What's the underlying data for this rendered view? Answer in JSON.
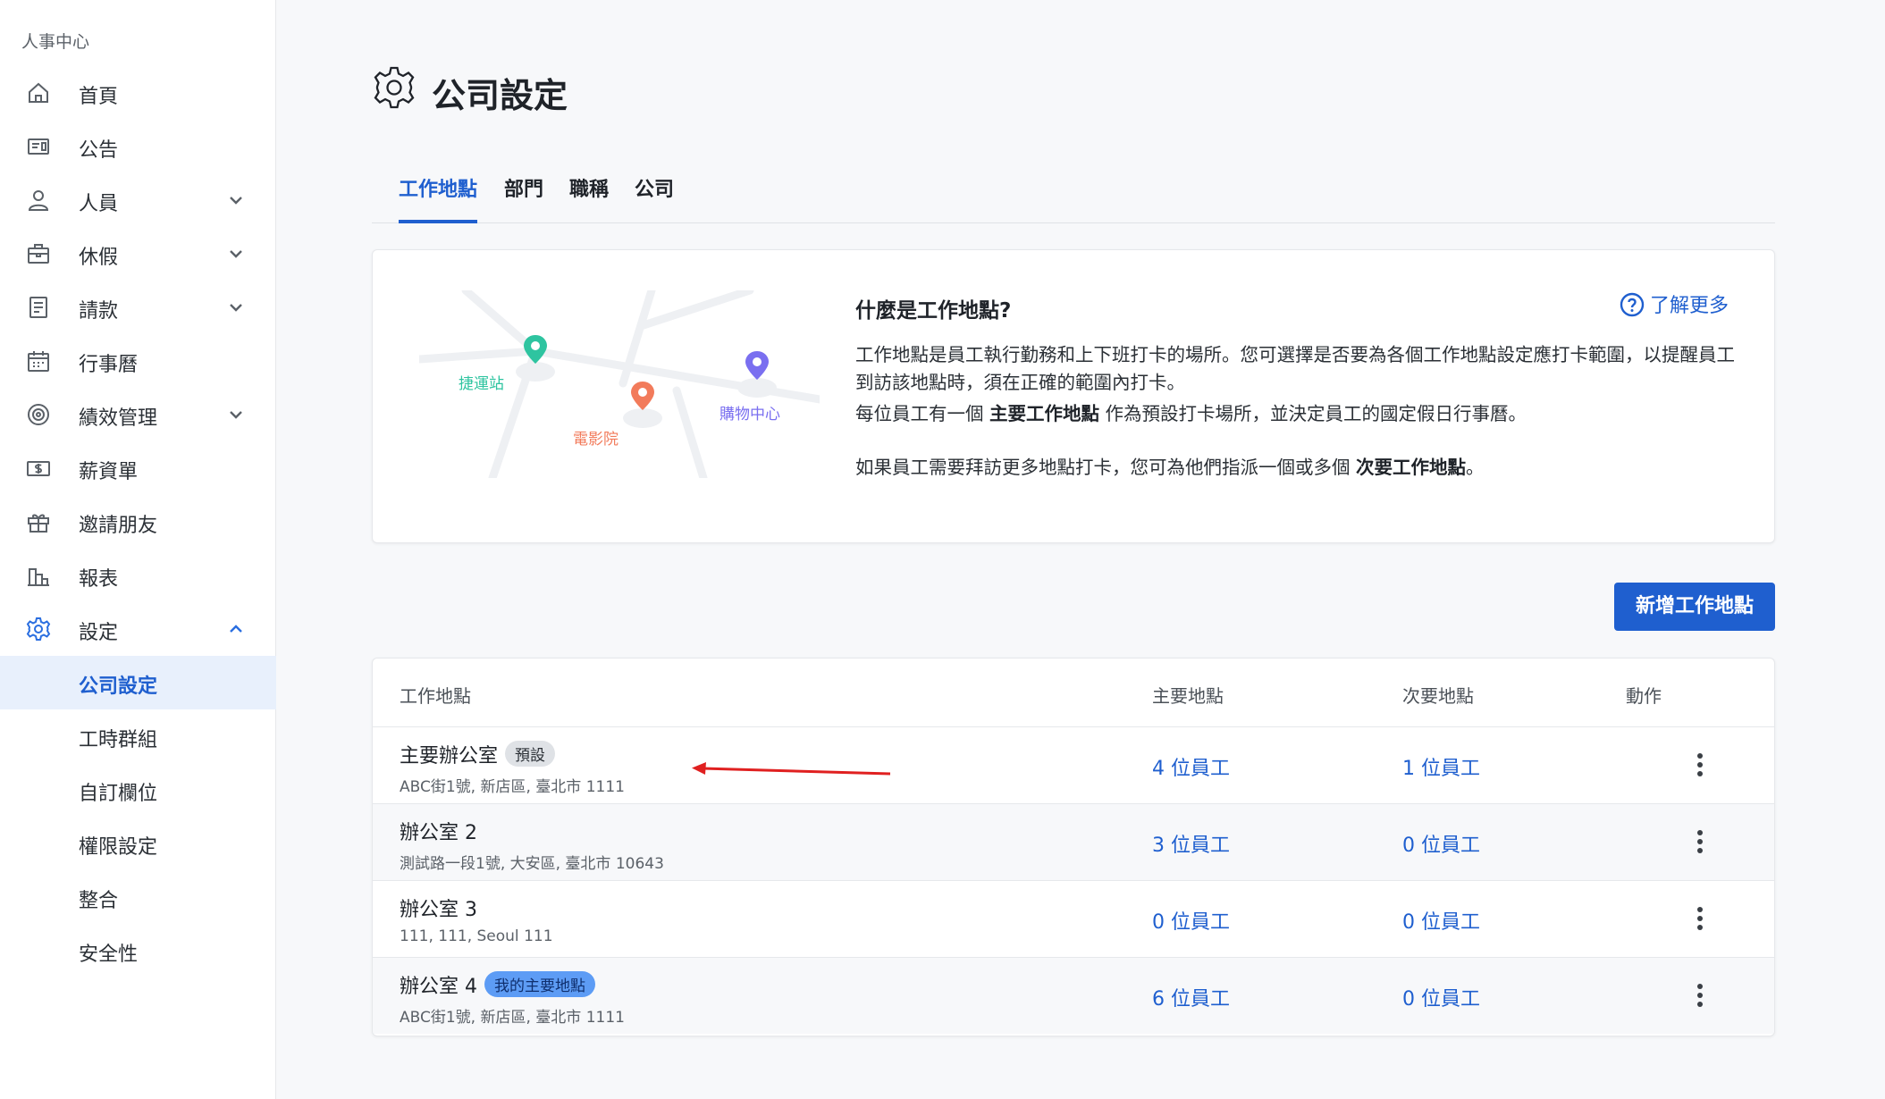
{
  "sidebar": {
    "org_name": "人事中心",
    "items": [
      {
        "label": "首頁",
        "icon": "home-icon"
      },
      {
        "label": "公告",
        "icon": "announcement-icon"
      },
      {
        "label": "人員",
        "icon": "person-icon"
      },
      {
        "label": "休假",
        "icon": "briefcase-icon"
      },
      {
        "label": "請款",
        "icon": "document-icon"
      },
      {
        "label": "行事曆",
        "icon": "calendar-icon"
      },
      {
        "label": "績效管理",
        "icon": "target-icon"
      },
      {
        "label": "薪資單",
        "icon": "payslip-icon"
      },
      {
        "label": "邀請朋友",
        "icon": "gift-icon"
      },
      {
        "label": "報表",
        "icon": "report-icon"
      },
      {
        "label": "設定",
        "icon": "gear-icon"
      }
    ],
    "sub_items": [
      {
        "label": "公司設定"
      },
      {
        "label": "工時群組"
      },
      {
        "label": "自訂欄位"
      },
      {
        "label": "權限設定"
      },
      {
        "label": "整合"
      },
      {
        "label": "安全性"
      }
    ]
  },
  "page": {
    "title": "公司設定",
    "tabs": [
      "工作地點",
      "部門",
      "職稱",
      "公司"
    ]
  },
  "info_card": {
    "map_labels": {
      "station": "捷運站",
      "cinema": "電影院",
      "mall": "購物中心"
    },
    "title": "什麼是工作地點?",
    "learn_more": "了解更多",
    "p1": "工作地點是員工執行勤務和上下班打卡的場所。您可選擇是否要為各個工作地點設定應打卡範圍，以提醒員工到訪該地點時，須在正確的範圍內打卡。",
    "p2_pre": "每位員工有一個 ",
    "p2_bold": "主要工作地點",
    "p2_post": " 作為預設打卡場所，並決定員工的國定假日行事曆。",
    "p3_pre": "如果員工需要拜訪更多地點打卡，您可為他們指派一個或多個 ",
    "p3_bold": "次要工作地點",
    "p3_post": "。"
  },
  "add_button": "新增工作地點",
  "table": {
    "headers": {
      "location": "工作地點",
      "primary": "主要地點",
      "secondary": "次要地點",
      "action": "動作"
    },
    "rows": [
      {
        "name": "主要辦公室",
        "badge": "預設",
        "address": "ABC街1號, 新店區, 臺北市 1111",
        "primary": "4 位員工",
        "secondary": "1 位員工"
      },
      {
        "name": "辦公室 2",
        "badge": "",
        "address": "測試路一段1號, 大安區, 臺北市 10643",
        "primary": "3 位員工",
        "secondary": "0 位員工"
      },
      {
        "name": "辦公室 3",
        "badge": "",
        "address": "111, 111, Seoul 111",
        "primary": "0 位員工",
        "secondary": "0 位員工"
      },
      {
        "name": "辦公室 4",
        "badge": "我的主要地點",
        "address": "ABC街1號, 新店區, 臺北市 1111",
        "primary": "6 位員工",
        "secondary": "0 位員工"
      }
    ]
  },
  "colors": {
    "accent": "#1f5fcf",
    "annotation_arrow": "#e02020"
  }
}
